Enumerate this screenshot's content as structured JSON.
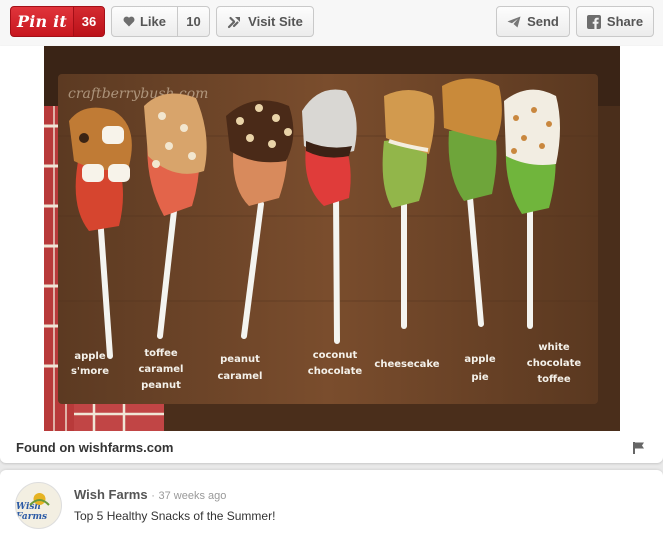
{
  "toolbar": {
    "pin_label": "Pin it",
    "pin_count": "36",
    "like_label": "Like",
    "like_count": "10",
    "visit_label": "Visit Site",
    "send_label": "Send",
    "share_label": "Share"
  },
  "image": {
    "watermark": "craftberrybush.com",
    "treats": [
      {
        "label": "apple s'more"
      },
      {
        "label": "toffee caramel peanut"
      },
      {
        "label": "peanut caramel"
      },
      {
        "label": "coconut chocolate"
      },
      {
        "label": "cheesecake"
      },
      {
        "label": "apple pie"
      },
      {
        "label": "white chocolate toffee"
      }
    ]
  },
  "source": {
    "found_on": "Found on wishfarms.com"
  },
  "attribution": {
    "avatar_text": "Wish Farms",
    "owner_name": "Wish Farms",
    "separator": "·",
    "time_ago": "37 weeks ago",
    "title": "Top 5 Healthy Snacks of the Summer!"
  },
  "colors": {
    "pin_red": "#cb2027",
    "wood": "#6b4429",
    "stick": "#f4f4f0"
  },
  "icons": [
    "heart-icon",
    "visit-site-icon",
    "send-icon",
    "facebook-icon",
    "flag-icon"
  ]
}
